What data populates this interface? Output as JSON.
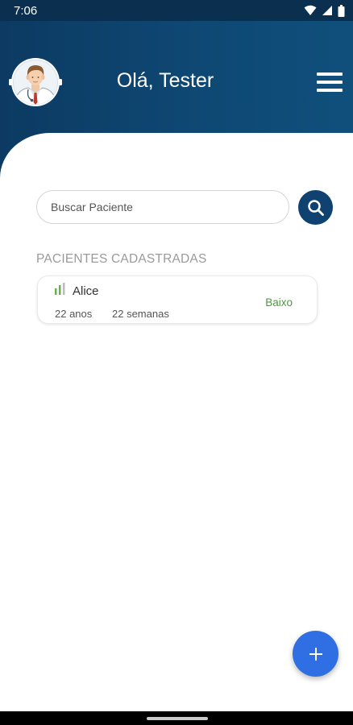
{
  "status_bar": {
    "time": "7:06"
  },
  "header": {
    "greeting": "Olá, Tester"
  },
  "search": {
    "placeholder": "Buscar Paciente",
    "value": ""
  },
  "patients": {
    "section_title": "PACIENTES CADASTRADAS",
    "items": [
      {
        "name": "Alice",
        "age": "22 anos",
        "gestation": "22 semanas",
        "risk": "Baixo"
      }
    ]
  },
  "colors": {
    "header_bg": "#0c3a62",
    "search_button_bg": "#0f4270",
    "fab_bg": "#2f6fe3",
    "risk_low": "#4b9a3c",
    "signal_active": "#6ab04c",
    "signal_inactive": "#bdbdbd"
  },
  "icons": {
    "avatar": "doctor-avatar-icon",
    "menu": "hamburger-menu-icon",
    "search": "search-icon",
    "signal": "signal-strength-icon",
    "add": "plus-icon"
  }
}
